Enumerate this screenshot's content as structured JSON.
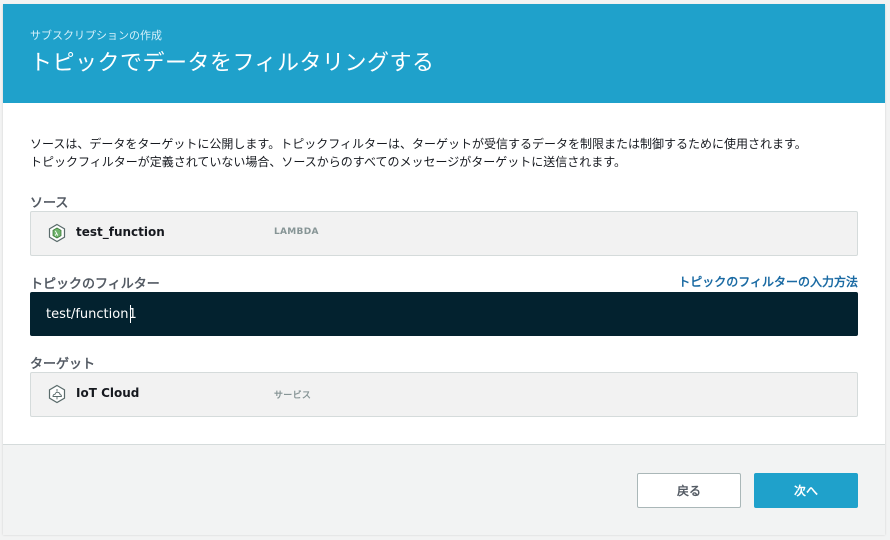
{
  "header": {
    "eyebrow": "サブスクリプションの作成",
    "title": "トピックでデータをフィルタリングする"
  },
  "description": {
    "line1": "ソースは、データをターゲットに公開します。トピックフィルターは、ターゲットが受信するデータを制限または制御するために使用されます。",
    "line2": "トピックフィルターが定義されていない場合、ソースからのすべてのメッセージがターゲットに送信されます。"
  },
  "source": {
    "label": "ソース",
    "name": "test_function",
    "type": "LAMBDA",
    "icon": "lambda-icon"
  },
  "topic_filter": {
    "label": "トピックのフィルター",
    "help_link": "トピックのフィルターの入力方法",
    "value": "test/function1"
  },
  "target": {
    "label": "ターゲット",
    "name": "IoT Cloud",
    "type": "サービス",
    "icon": "iot-cloud-icon"
  },
  "footer": {
    "back_label": "戻る",
    "next_label": "次へ"
  },
  "colors": {
    "header": "#1fa1cb",
    "input_bg": "#03222f",
    "link": "#1a6aa3",
    "primary_button": "#1fa1cb"
  }
}
